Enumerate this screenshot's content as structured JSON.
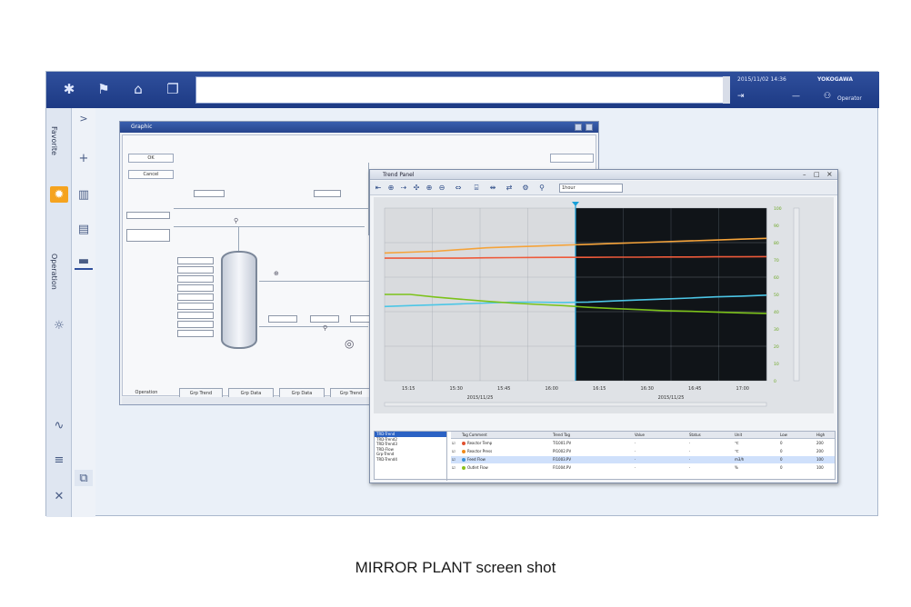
{
  "caption": "MIRROR PLANT screen shot",
  "topbar": {
    "datetime": "2015/11/02 14:36",
    "brand": "YOKOGAWA",
    "user": "Operator"
  },
  "sidebar": {
    "labels": [
      "Favorite",
      "Operation"
    ]
  },
  "graphic_window": {
    "title": "Graphic",
    "buttons": [
      "OK",
      "Cancel"
    ],
    "bottom_tabs": [
      "Operation",
      "Grp Trend",
      "Grp Data",
      "Grp Data",
      "Grp Trend"
    ]
  },
  "trend_window": {
    "title": "Trend Panel",
    "select_value": "1hour",
    "list_items": [
      "TRD-Trend",
      "TRD-Trend2",
      "TRD-Trend3",
      "TRD-Flow",
      "Grp-Trend",
      "TRD-Trend4"
    ]
  },
  "trend_table": {
    "headers": [
      "Tag Comment",
      "Trend Tag",
      "Value",
      "Status",
      "Unit",
      "Low",
      "High"
    ],
    "rows": [
      {
        "color": "#e0502f",
        "comment": "Reactor Temp",
        "tag": "TI1001.PV",
        "value": "-",
        "status": "-",
        "unit": "℃",
        "low": "0",
        "high": "200"
      },
      {
        "color": "#f08a1a",
        "comment": "Reactor Press",
        "tag": "PI1002.PV",
        "value": "-",
        "status": "-",
        "unit": "℃",
        "low": "0",
        "high": "200"
      },
      {
        "color": "#3a8fd8",
        "comment": "Feed Flow",
        "tag": "FI1003.PV",
        "value": "-",
        "status": "-",
        "unit": "m3/h",
        "low": "0",
        "high": "100"
      },
      {
        "color": "#8ac01a",
        "comment": "Outlet Flow",
        "tag": "FI1004.PV",
        "value": "-",
        "status": "-",
        "unit": "%",
        "low": "0",
        "high": "100"
      }
    ]
  },
  "chart_data": {
    "type": "line",
    "background_past": "#d9dbde",
    "background_future": "#101418",
    "split_at": 0.5,
    "xlabels": [
      "15:15",
      "15:30",
      "15:45",
      "16:00",
      "16:15",
      "16:30",
      "16:45",
      "17:00"
    ],
    "date_labels": [
      "2015/11/25",
      "2015/11/25"
    ],
    "ylim": [
      0,
      100
    ],
    "yticks_right": [
      "100",
      "90",
      "80",
      "70",
      "60",
      "50",
      "40",
      "30",
      "20",
      "10",
      "0"
    ],
    "grid": true,
    "series": [
      {
        "color": "#f5a33a",
        "values": [
          74,
          74.5,
          75,
          76,
          77,
          77.5,
          78,
          78.5,
          79,
          79.5,
          80,
          80.5,
          81,
          81.5,
          82,
          82.5
        ]
      },
      {
        "color": "#ee5a3a",
        "values": [
          71,
          71,
          71,
          71,
          71.2,
          71.3,
          71.4,
          71.5,
          71.5,
          71.6,
          71.6,
          71.7,
          71.7,
          71.8,
          71.8,
          71.9
        ]
      },
      {
        "color": "#4cc6e6",
        "values": [
          43,
          43.5,
          44,
          44.5,
          45,
          45.5,
          45.5,
          45.3,
          45.6,
          46.2,
          46.8,
          47.3,
          47.9,
          48.6,
          49,
          49.6
        ]
      },
      {
        "color": "#7cc21a",
        "values": [
          50,
          50,
          48.5,
          47.2,
          46,
          45,
          44.2,
          43.5,
          42.5,
          41.8,
          41.2,
          40.6,
          40.2,
          39.8,
          39.3,
          39
        ]
      }
    ]
  }
}
